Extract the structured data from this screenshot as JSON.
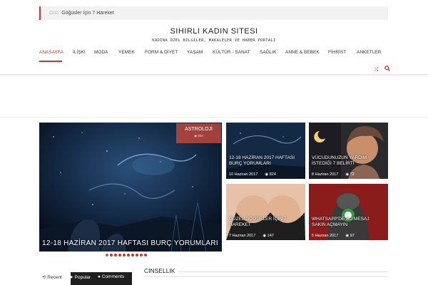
{
  "ticker": {
    "label": "Gün",
    "headline": "Göğüsler İçin 7 Hareket"
  },
  "site": {
    "title": "SIHIRLI KADIN SITESI",
    "tagline": "KADINA ÖZEL BILGILER, MAKALELER VE HABER PORTALI"
  },
  "nav": {
    "items": [
      "ANASAYFA",
      "İLİŞKİ",
      "MODA",
      "YEMEK",
      "FORM & DİYET",
      "YAŞAM",
      "KÜLTÜR - SANAT",
      "SAĞLIK",
      "ANNE & BEBEK",
      "FİHRİST",
      "ANKETLER"
    ],
    "icons": [
      "shuffle-icon",
      "search-icon"
    ]
  },
  "featured": {
    "category": "ASTROLOJİ",
    "views": "824",
    "title": "12-18 HAZİRAN 2017 HAFTASI BURÇ YORUMLARI"
  },
  "tiles": [
    {
      "title": "12-18 HAZİRAN 2017 HAFTASI BURÇ YORUMLARI",
      "date": "10 Haziran 2017",
      "views": "824"
    },
    {
      "title": "VÜCUDUNUZUN YARDIM İSTEDİĞİ 7 BELİRTİ",
      "date": "8 Haziran 2017",
      "views": "72"
    },
    {
      "title": "GÜZEL GÖĞÜSLER İÇİN 7 HAREKET",
      "date": "7 Haziran 2017",
      "views": "147"
    },
    {
      "title": "WHATSAPP'DE BU MESAJ SAKIN AÇMAYIN",
      "date": "5 Haziran 2017",
      "views": "97"
    }
  ],
  "tabs": [
    "Recent",
    "Popular",
    "Comments"
  ],
  "section": {
    "heading": "CINSELLIK"
  },
  "colors": {
    "accent": "#d32f2f"
  }
}
